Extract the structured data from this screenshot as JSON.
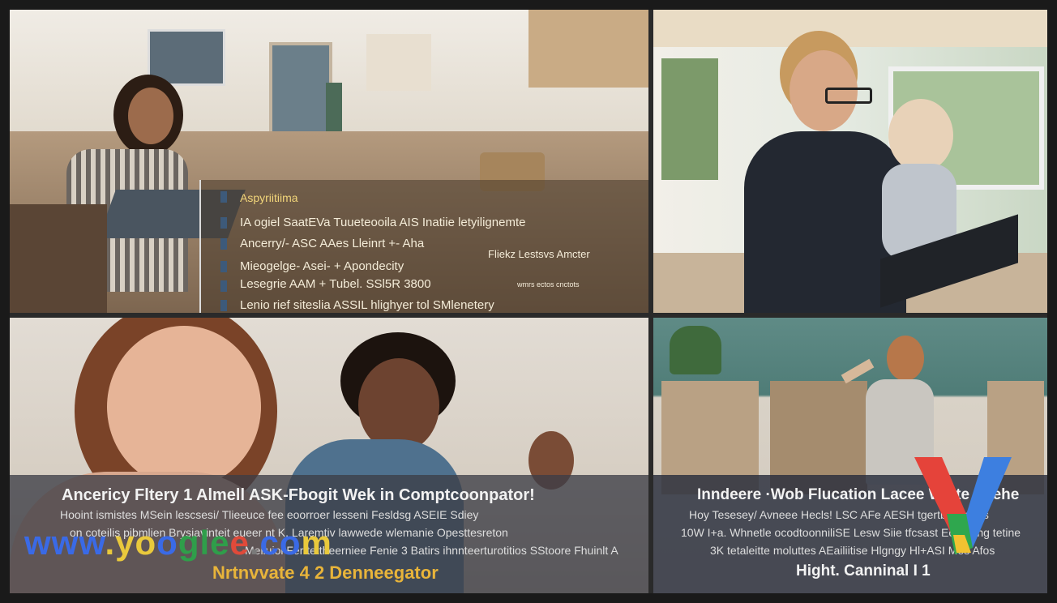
{
  "panels": {
    "top_left": {
      "overlay_lines": [
        "Aspyriitiima",
        "IA ogiel SaatEVa Tuueteooila AIS Inatiie letyilignemte",
        "Ancerry/- ASC AAes Lleinrt +- Aha",
        "Fliekz Lestsvs Amcter",
        "Mieogelge- Asei- + Apondecity",
        "Lesegrie AAM + Tubel. SSl5R 3800",
        "Lenio rief siteslia ASSIL hlighyer tol SMlenetery"
      ],
      "small_note": "wmrs ectos cnctots"
    },
    "bottom_left": {
      "title": "Ancericy Fltery 1 Almell ASK-Fbogit Wek in Comptcoonpator!",
      "body_lines": [
        "Hooint ismistes MSein lescsesi/ Tlieeuce fee eoorroer lesseni Fesldsg ASEIE Sdiey",
        "on coteilis pibmlien Brysiavinteit eueer nt K. Laremtiv lawwede wlemanie Opesttesreton",
        "Melluiol Fer tettheerniee Fenie 3 Batirs ihnnteerturotitios SStoore Fhuinlt A"
      ],
      "accent": "Nrtnvvate 4 2 Denneegator"
    },
    "bottom_right": {
      "title": "Inndeere ·Wob Flucation Lacee Welte hnehe",
      "body_lines": [
        "Hoy Tesesey/ Avneee Hecls! LSC AFe AESH tgertbnelictrgs",
        "10W I+a. Whnetle ocodtoonniliSE Lesw Siie tfcsast Eoorming tetine",
        "3K tetaleitte moluttes AEailiitise Hlgngy Hl+ASI Mes Afos"
      ],
      "footer": "Hight. Canninal I 1"
    }
  },
  "watermark": {
    "text": "www.yooglee.com",
    "letters": [
      "w",
      "w",
      "w",
      ".",
      "y",
      "o",
      "o",
      "g",
      "l",
      "e",
      "e",
      ".",
      "c",
      "o",
      "m"
    ],
    "colors": [
      "#3a6ae6",
      "#3a6ae6",
      "#3a6ae6",
      "#e9c93c",
      "#e9c93c",
      "#e9c93c",
      "#3a6ae6",
      "#2f9e4a",
      "#2f9e4a",
      "#2f9e4a",
      "#e04a3a",
      "#7a7a7a",
      "#3a6ae6",
      "#3a6ae6",
      "#e9c93c"
    ]
  },
  "logo": {
    "colors": [
      "#e5433a",
      "#3d7fe0",
      "#2fa74e",
      "#f2c231"
    ]
  }
}
